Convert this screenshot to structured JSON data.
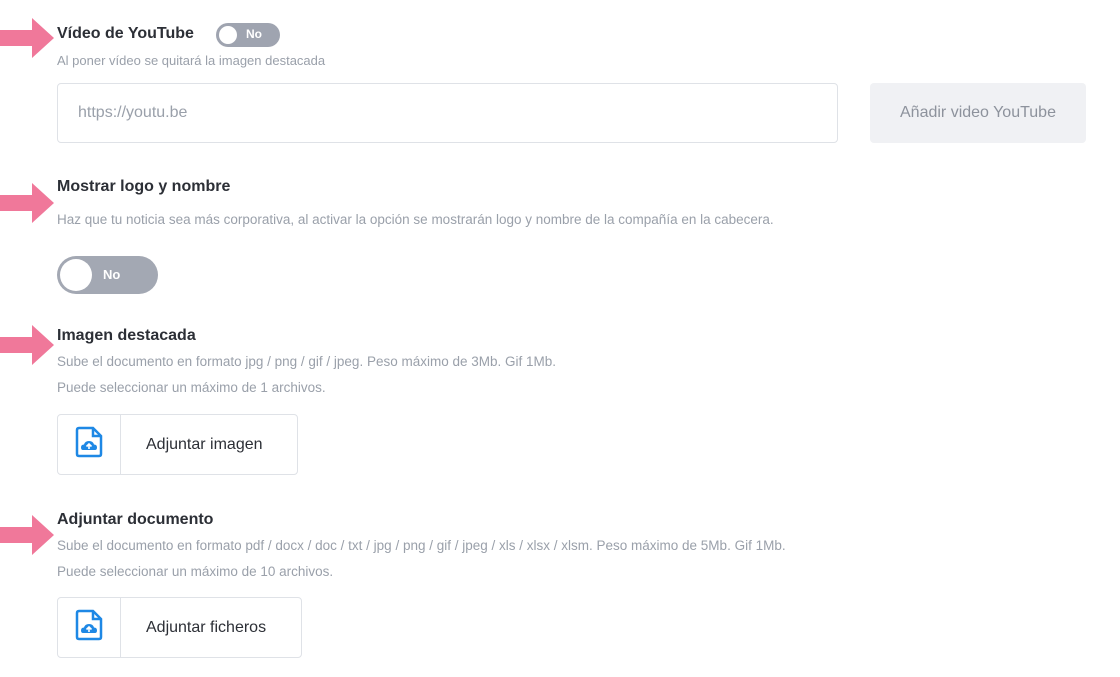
{
  "youtube": {
    "title": "Vídeo de YouTube",
    "toggle_label": "No",
    "help": "Al poner vídeo se quitará la imagen destacada",
    "url_placeholder": "https://youtu.be",
    "url_value": "",
    "add_button": "Añadir video YouTube"
  },
  "logo": {
    "title": "Mostrar logo y nombre",
    "help": "Haz que tu noticia sea más corporativa, al activar la opción se mostrarán logo y nombre de la compañía en la cabecera.",
    "toggle_label": "No"
  },
  "image": {
    "title": "Imagen destacada",
    "help_formats": "Sube el documento en formato jpg / png / gif / jpeg. Peso máximo de 3Mb. Gif 1Mb.",
    "help_count": "Puede seleccionar un máximo de 1 archivos.",
    "button_label": "Adjuntar imagen",
    "icon": "file-upload-icon"
  },
  "document": {
    "title": "Adjuntar documento",
    "help_formats": "Sube el documento en formato pdf / docx / doc / txt / jpg / png / gif / jpeg / xls / xlsx / xlsm. Peso máximo de 5Mb. Gif 1Mb.",
    "help_count": "Puede seleccionar un máximo de 10 archivos.",
    "button_label": "Adjuntar ficheros",
    "icon": "file-upload-icon"
  },
  "colors": {
    "arrow": "#f0789a",
    "toggle_off": "#a3a8b3",
    "upload_icon": "#1e88e5"
  }
}
